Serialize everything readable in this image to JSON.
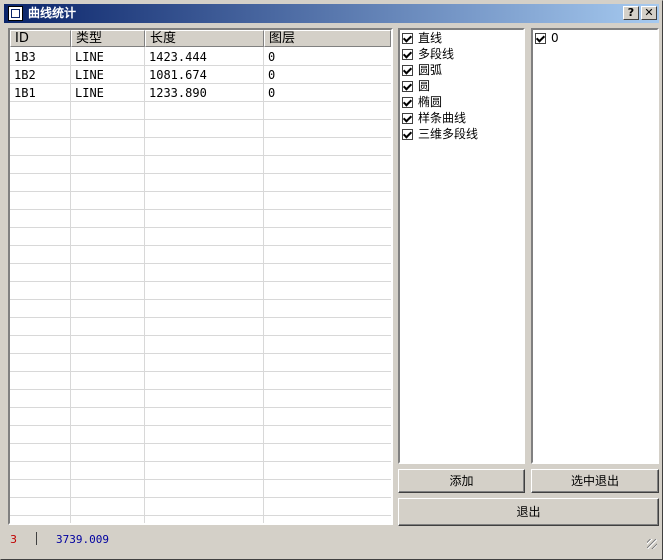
{
  "window": {
    "title": "曲线统计",
    "help_label": "?",
    "close_label": "✕"
  },
  "grid": {
    "columns": [
      "ID",
      "类型",
      "长度",
      "图层"
    ],
    "rows": [
      [
        "1B3",
        "LINE",
        "1423.444",
        "0"
      ],
      [
        "1B2",
        "LINE",
        "1081.674",
        "0"
      ],
      [
        "1B1",
        "LINE",
        "1233.890",
        "0"
      ]
    ]
  },
  "type_filters": [
    {
      "label": "直线",
      "checked": true
    },
    {
      "label": "多段线",
      "checked": true
    },
    {
      "label": "圆弧",
      "checked": true
    },
    {
      "label": "圆",
      "checked": true
    },
    {
      "label": "椭圆",
      "checked": true
    },
    {
      "label": "样条曲线",
      "checked": true
    },
    {
      "label": "三维多段线",
      "checked": true
    }
  ],
  "layer_filters": [
    {
      "label": "0",
      "checked": true
    }
  ],
  "buttons": {
    "add": "添加",
    "select_exit": "选中退出",
    "exit": "退出"
  },
  "status": {
    "count": "3",
    "separator": "|",
    "total": "3739.009"
  },
  "colors": {
    "title_start": "#0a246a",
    "title_end": "#a6caf0",
    "face": "#d4d0c8",
    "count_text": "#c00000",
    "total_text": "#0000a0"
  }
}
